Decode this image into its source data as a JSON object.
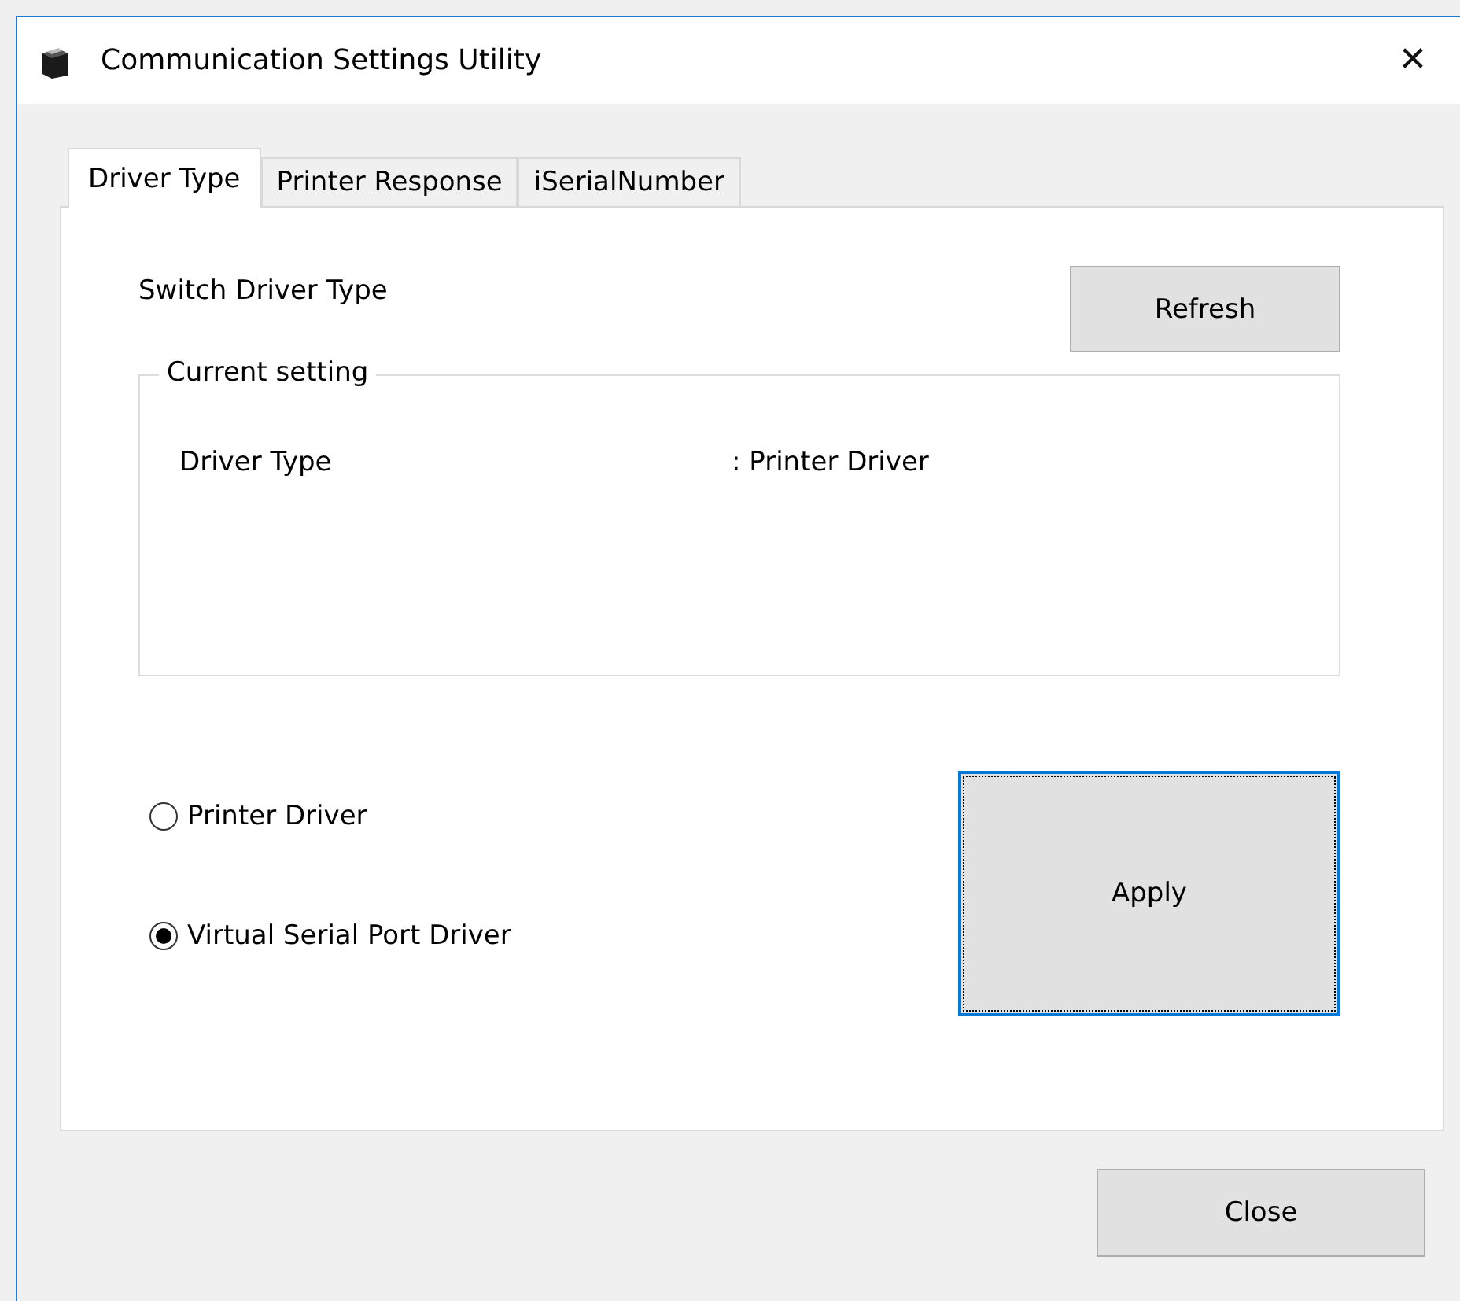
{
  "window": {
    "title": "Communication Settings Utility",
    "close_glyph": "✕"
  },
  "tabs": [
    {
      "label": "Driver Type",
      "selected": true
    },
    {
      "label": "Printer Response",
      "selected": false
    },
    {
      "label": "iSerialNumber",
      "selected": false
    }
  ],
  "heading": "Switch Driver Type",
  "refresh_button": "Refresh",
  "current_setting": {
    "legend": "Current setting",
    "rows": [
      {
        "label": "Driver Type",
        "value": ": Printer Driver"
      }
    ]
  },
  "options": [
    {
      "label": "Printer Driver",
      "selected": false
    },
    {
      "label": "Virtual Serial Port Driver",
      "selected": true
    }
  ],
  "apply_button": {
    "label": "Apply",
    "focused": true
  },
  "close_button": "Close"
}
